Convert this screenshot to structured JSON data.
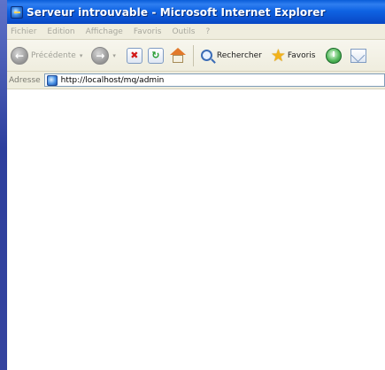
{
  "window": {
    "title": "Serveur introuvable - Microsoft Internet Explorer"
  },
  "menu": {
    "items": [
      "Fichier",
      "Edition",
      "Affichage",
      "Favoris",
      "Outils",
      "?"
    ]
  },
  "toolbar": {
    "back_label": "Précédente",
    "search_label": "Rechercher",
    "favorites_label": "Favoris"
  },
  "address": {
    "label": "Adresse",
    "url": "http://localhost/mq/admin"
  }
}
